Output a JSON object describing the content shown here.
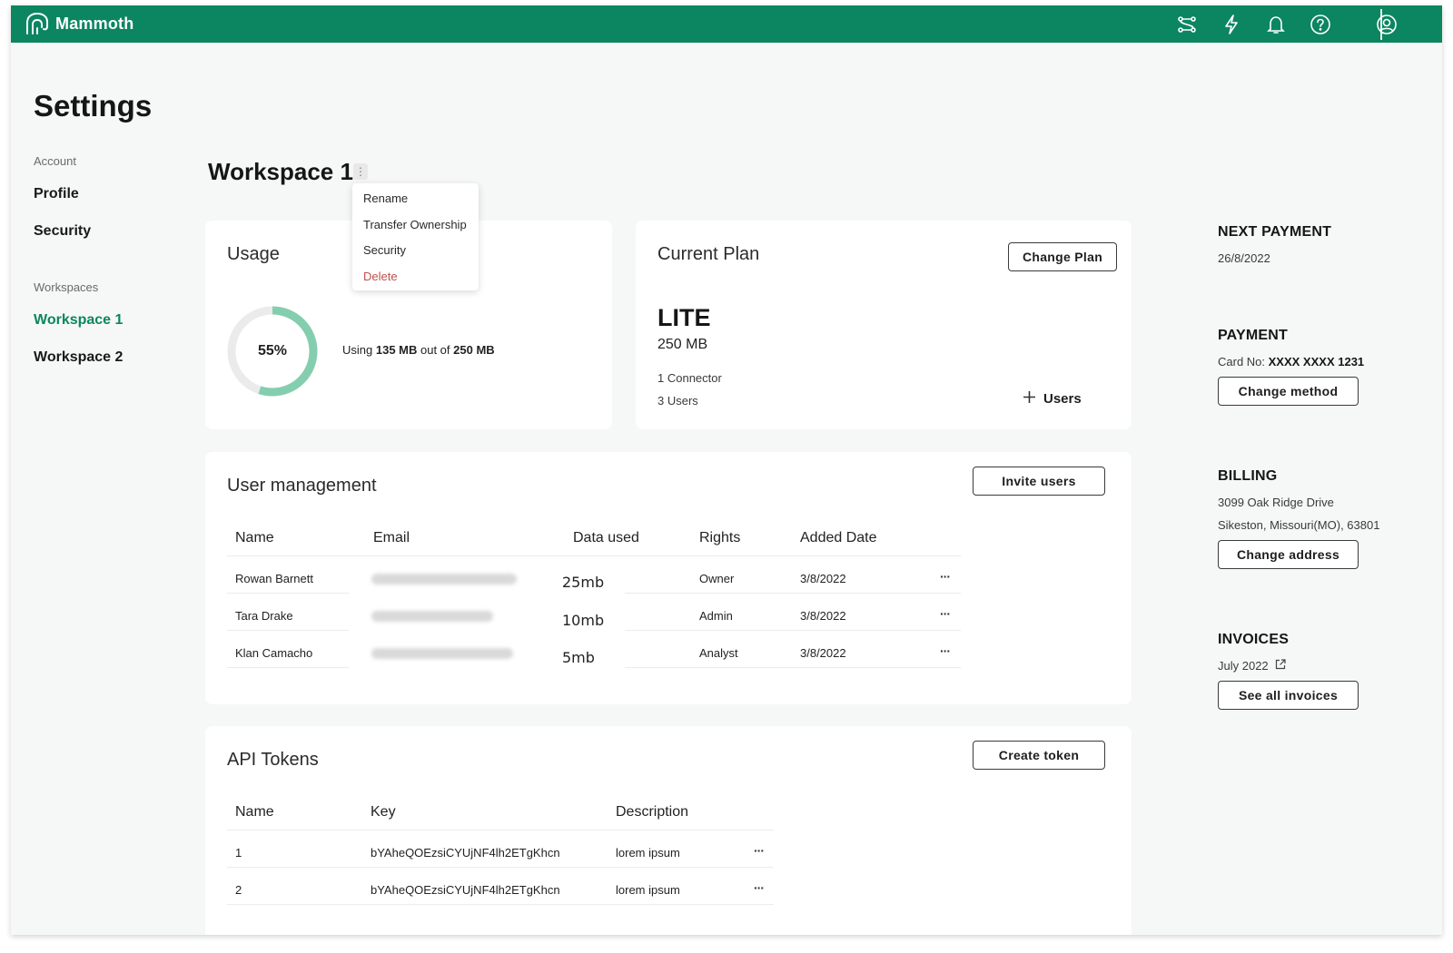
{
  "app": {
    "name": "Mammoth"
  },
  "topbar_icons": [
    "connections-icon",
    "lightning-icon",
    "bell-icon",
    "help-icon",
    "user-avatar-icon"
  ],
  "colors": {
    "brand": "#0b8660",
    "danger": "#c0504d",
    "donut_fill": "#84ceaf",
    "donut_track": "#ebebeb"
  },
  "page": {
    "title": "Settings"
  },
  "nav": {
    "account_label": "Account",
    "account_items": [
      "Profile",
      "Security"
    ],
    "workspaces_label": "Workspaces",
    "workspace_items": [
      "Workspace 1",
      "Workspace 2"
    ],
    "active": "Workspace 1"
  },
  "workspace": {
    "title": "Workspace 1"
  },
  "menu": {
    "items": [
      "Rename",
      "Transfer Ownership",
      "Security",
      "Delete"
    ]
  },
  "usage": {
    "title": "Usage",
    "percent_label": "55%",
    "percent": 55,
    "text_prefix": "Using ",
    "used": "135 MB",
    "text_mid": " out of ",
    "total": "250 MB"
  },
  "plan": {
    "title": "Current Plan",
    "change_label": "Change Plan",
    "name": "LITE",
    "size": "250 MB",
    "connectors": "1 Connector",
    "users": "3 Users",
    "add_users_label": "Users"
  },
  "user_management": {
    "title": "User management",
    "invite_label": "Invite users",
    "columns": [
      "Name",
      "Email",
      "Data used",
      "Rights",
      "Added Date"
    ],
    "rows": [
      {
        "name": "Rowan Barnett",
        "data": "25mb",
        "rights": "Owner",
        "date": "3/8/2022"
      },
      {
        "name": "Tara Drake",
        "data": "10mb",
        "rights": "Admin",
        "date": "3/8/2022"
      },
      {
        "name": "Klan Camacho",
        "data": "5mb",
        "rights": "Analyst",
        "date": "3/8/2022"
      }
    ],
    "more_label": "···"
  },
  "api_tokens": {
    "title": "API Tokens",
    "create_label": "Create token",
    "columns": [
      "Name",
      "Key",
      "Description"
    ],
    "rows": [
      {
        "name": "1",
        "key": "bYAheQOEzsiCYUjNF4lh2ETgKhcn",
        "desc": "lorem ipsum"
      },
      {
        "name": "2",
        "key": "bYAheQOEzsiCYUjNF4lh2ETgKhcn",
        "desc": "lorem ipsum"
      }
    ],
    "more_label": "···"
  },
  "sidebar": {
    "next_payment": {
      "title": "NEXT PAYMENT",
      "date": "26/8/2022"
    },
    "payment": {
      "title": "PAYMENT",
      "card_prefix": "Card No: ",
      "card": "XXXX XXXX 1231",
      "button": "Change method"
    },
    "billing": {
      "title": "BILLING",
      "line1": "3099 Oak Ridge Drive",
      "line2": "Sikeston, Missouri(MO), 63801",
      "button": "Change address"
    },
    "invoices": {
      "title": "INVOICES",
      "latest": "July 2022",
      "button": "See all invoices"
    }
  }
}
